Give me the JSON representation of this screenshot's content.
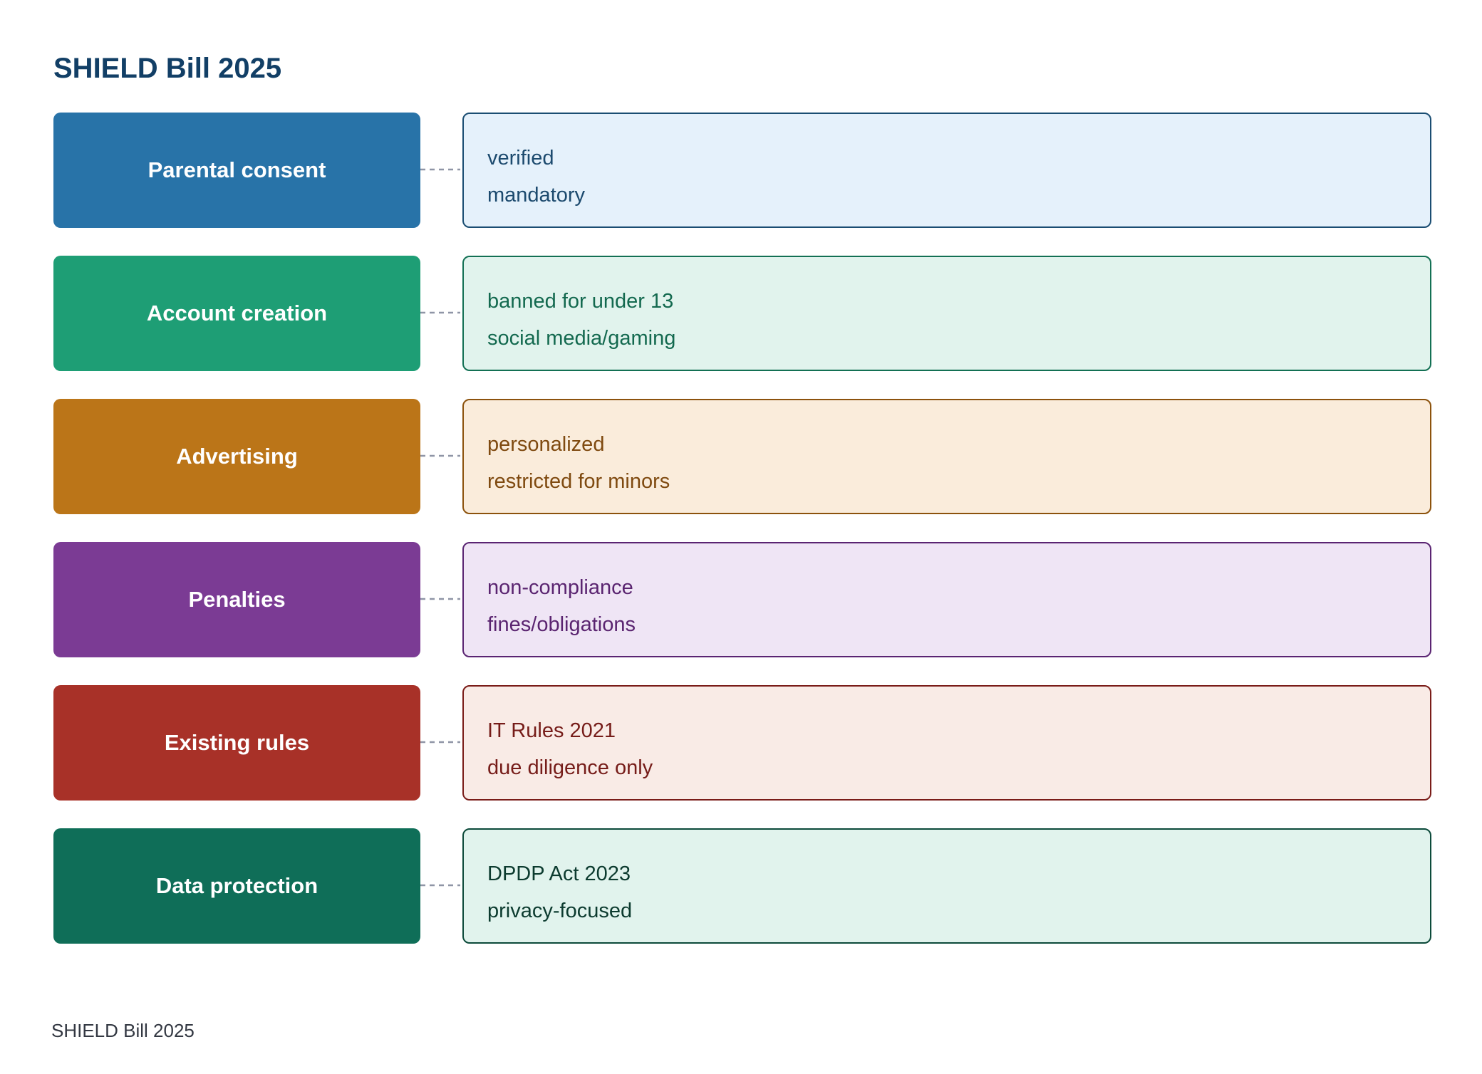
{
  "title": "SHIELD Bill 2025",
  "footer": "SHIELD Bill 2025",
  "rows": [
    {
      "label": "Parental consent",
      "details": [
        "verified",
        "mandatory"
      ],
      "colors": {
        "label_bg": "#2873a8",
        "detail_bg": "#e5f1fb",
        "detail_border": "#1a4d72",
        "detail_text": "#1c4a6e"
      }
    },
    {
      "label": "Account creation",
      "details": [
        "banned for under 13",
        "social media/gaming"
      ],
      "colors": {
        "label_bg": "#1e9e75",
        "detail_bg": "#e1f3ed",
        "detail_border": "#137054",
        "detail_text": "#13694f"
      }
    },
    {
      "label": "Advertising",
      "details": [
        "personalized",
        "restricted for minors"
      ],
      "colors": {
        "label_bg": "#bb7518",
        "detail_bg": "#faecdb",
        "detail_border": "#8c520c",
        "detail_text": "#7f4a10"
      }
    },
    {
      "label": "Penalties",
      "details": [
        "non-compliance",
        "fines/obligations"
      ],
      "colors": {
        "label_bg": "#7b3b94",
        "detail_bg": "#efe5f5",
        "detail_border": "#5a2472",
        "detail_text": "#5a2470"
      }
    },
    {
      "label": "Existing rules",
      "details": [
        "IT Rules 2021",
        "due diligence only"
      ],
      "colors": {
        "label_bg": "#a83128",
        "detail_bg": "#f9ebe6",
        "detail_border": "#7a1c18",
        "detail_text": "#761c19"
      }
    },
    {
      "label": "Data protection",
      "details": [
        "DPDP Act 2023",
        "privacy-focused"
      ],
      "colors": {
        "label_bg": "#0f6e58",
        "detail_bg": "#e1f3ed",
        "detail_border": "#0c4a3a",
        "detail_text": "#0c3b2f"
      }
    }
  ],
  "connector_color": "#8f95a6"
}
